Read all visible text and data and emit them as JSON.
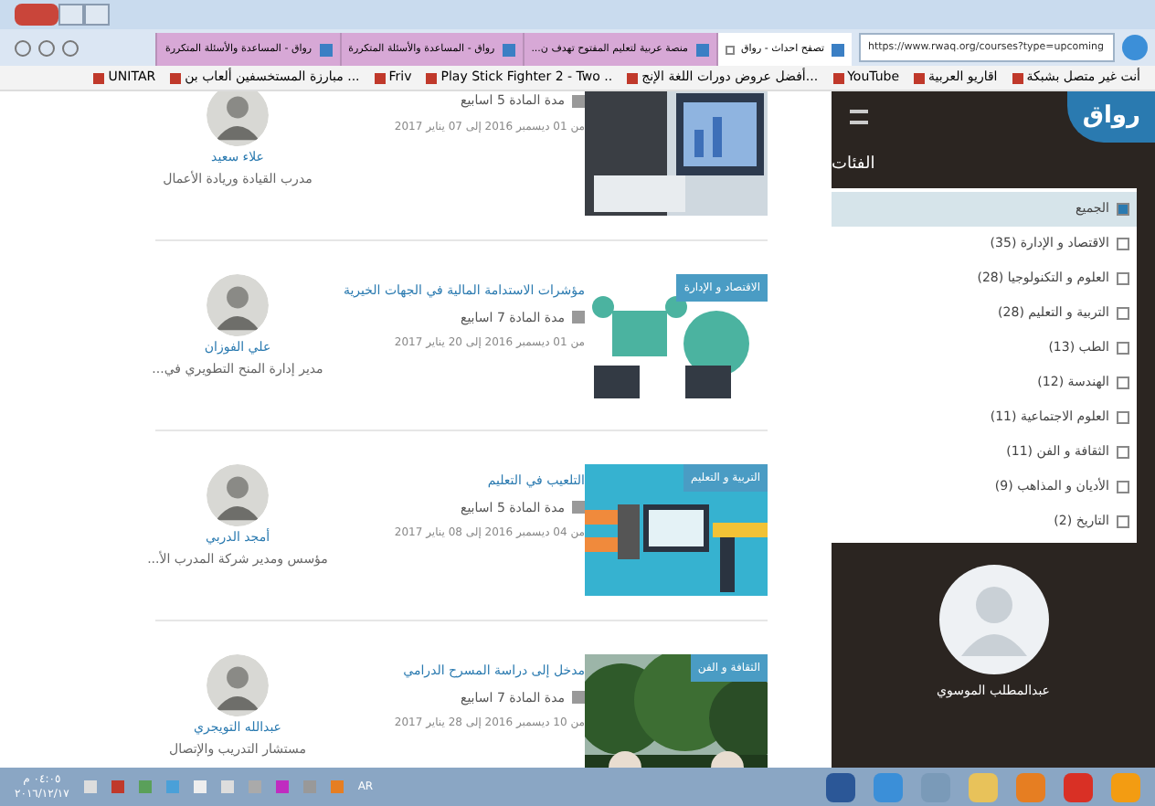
{
  "browser": {
    "tabs": [
      {
        "label": "تصفح احداث - رواق",
        "selected": true
      },
      {
        "label": "منصة عربية لتعليم المفتوح تهدف ن...",
        "selected": false
      },
      {
        "label": "رواق - المساعدة والأسئلة المتكررة",
        "selected": false
      },
      {
        "label": "رواق - المساعدة والأسئلة المتكررة",
        "selected": false
      }
    ],
    "url": "https://www.rwaq.org/courses?type=upcoming",
    "bookmarks": [
      "أنت غير متصل بشبكة",
      "اقاريو العربية",
      "YouTube",
      "أفضل عروض دورات اللغة الإنج...",
      "Play Stick Fighter 2 - Two ..",
      "Friv",
      "مبارزة المستخسفين ألعاب بن ...",
      "UNITAR"
    ]
  },
  "courses": [
    {
      "instructor": "علاء سعيد",
      "role": "مدرب القيادة وريادة الأعمال",
      "duration": "مدة المادة 5 اسابيع",
      "dates": "من 01 ديسمبر 2016 إلى 07 يناير 2017"
    },
    {
      "title": "مؤشرات الاستدامة المالية في الجهات الخيرية",
      "category": "الاقتصاد و الإدارة",
      "instructor": "علي الفوزان",
      "role": "مدير إدارة المنح التطويري في...",
      "duration": "مدة المادة 7 اسابيع",
      "dates": "من 01 ديسمبر 2016 إلى 20 يناير 2017"
    },
    {
      "title": "التلعيب في التعليم",
      "category": "التربية و التعليم",
      "instructor": "أمجد الدربي",
      "role": "مؤسس ومدير شركة المدرب الأ...",
      "duration": "مدة المادة 5 اسابيع",
      "dates": "من 04 ديسمبر 2016 إلى 08 يناير 2017"
    },
    {
      "title": "مدخل إلى دراسة المسرح الدرامي",
      "category": "الثقافة و الفن",
      "instructor": "عبدالله التويجري",
      "role": "مستشار التدريب والإتصال",
      "duration": "مدة المادة 7 اسابيع",
      "dates": "من 10 ديسمبر 2016 إلى 28 يناير 2017"
    }
  ],
  "sidebar": {
    "logo": "رواق",
    "heading": "الفئات",
    "categories": [
      {
        "label": "الجميع",
        "checked": true
      },
      {
        "label": "الاقتصاد و الإدارة (35)",
        "checked": false
      },
      {
        "label": "العلوم و التكنولوجيا (28)",
        "checked": false
      },
      {
        "label": "التربية و التعليم (28)",
        "checked": false
      },
      {
        "label": "الطب (13)",
        "checked": false
      },
      {
        "label": "الهندسة (12)",
        "checked": false
      },
      {
        "label": "العلوم الاجتماعية (11)",
        "checked": false
      },
      {
        "label": "الثقافة و الفن (11)",
        "checked": false
      },
      {
        "label": "الأديان و المذاهب (9)",
        "checked": false
      },
      {
        "label": "التاريخ (2)",
        "checked": false
      }
    ],
    "user": "عبدالمطلب الموسوي"
  },
  "taskbar": {
    "time": "٠٤:٠٥ م",
    "date": "٢٠١٦/١٢/١٧",
    "language": "AR"
  }
}
